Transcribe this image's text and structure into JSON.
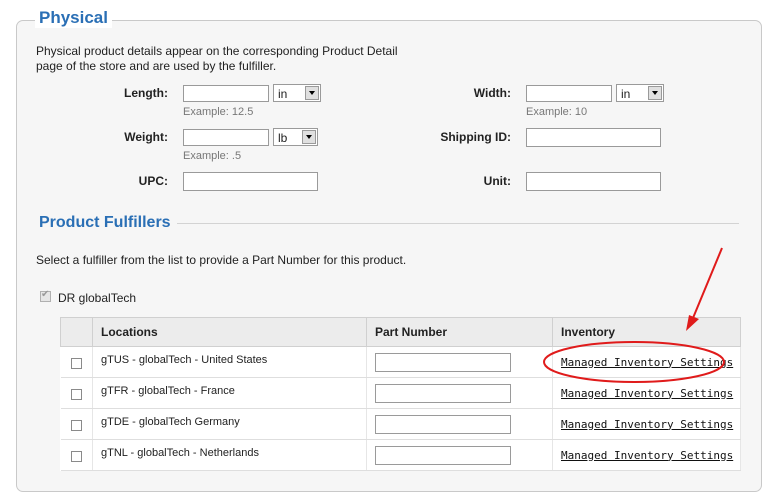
{
  "physical": {
    "legend": "Physical",
    "description": "Physical product details appear on the corresponding Product Detail page of the store and are used by the fulfiller.",
    "length": {
      "label": "Length:",
      "value": "",
      "unit": "in",
      "example": "Example: 12.5"
    },
    "width": {
      "label": "Width:",
      "value": "",
      "unit": "in",
      "example": "Example: 10"
    },
    "weight": {
      "label": "Weight:",
      "value": "",
      "unit": "lb",
      "example": "Example: .5"
    },
    "shipping_id": {
      "label": "Shipping ID:",
      "value": ""
    },
    "upc": {
      "label": "UPC:",
      "value": ""
    },
    "unit_field": {
      "label": "Unit:",
      "value": ""
    }
  },
  "fulfillers": {
    "title": "Product Fulfillers",
    "intro": "Select a fulfiller from the list to provide a Part Number for this product.",
    "fulfiller": {
      "name": "DR globalTech",
      "checked": true
    },
    "table": {
      "headers": [
        "Locations",
        "Part Number",
        "Inventory"
      ],
      "rows": [
        {
          "location": "gTUS - globalTech - United States",
          "part_number": "",
          "inventory_link": "Managed Inventory Settings"
        },
        {
          "location": "gTFR - globalTech - France",
          "part_number": "",
          "inventory_link": "Managed Inventory Settings"
        },
        {
          "location": "gTDE - globalTech Germany",
          "part_number": "",
          "inventory_link": "Managed Inventory Settings"
        },
        {
          "location": "gTNL - globalTech - Netherlands",
          "part_number": "",
          "inventory_link": "Managed Inventory Settings"
        }
      ]
    }
  },
  "colors": {
    "accent": "#2a6fb5",
    "annotation": "#e01b1b"
  }
}
